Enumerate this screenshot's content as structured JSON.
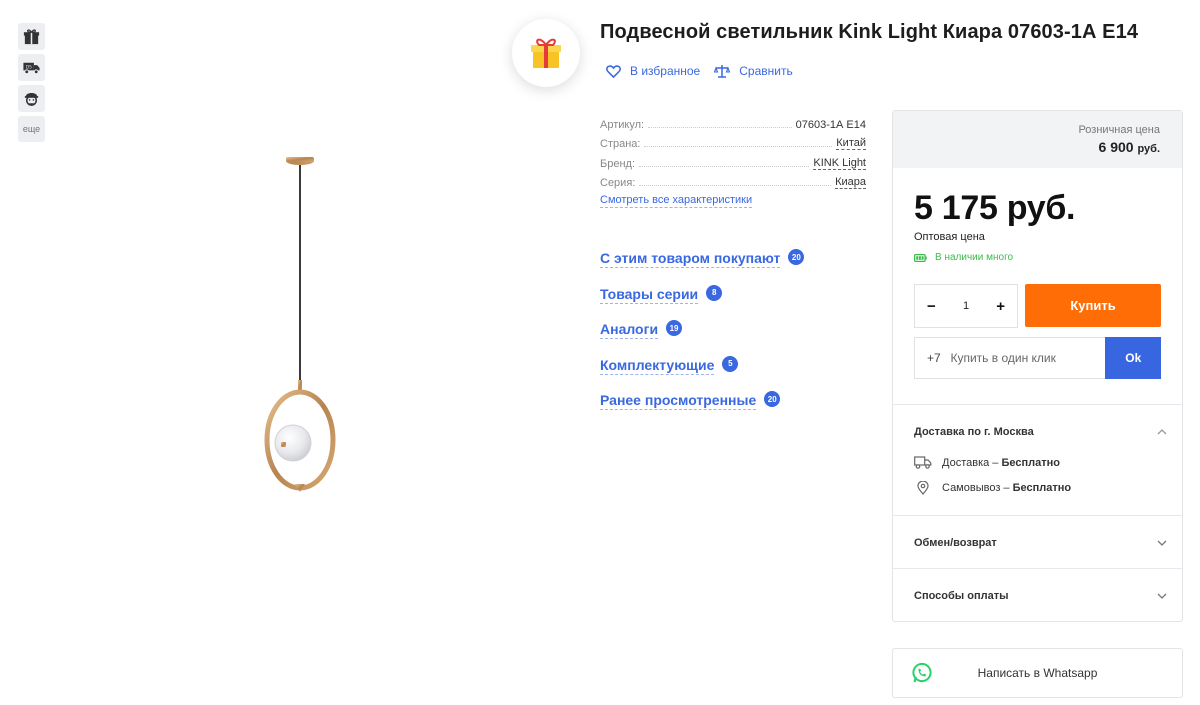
{
  "badges": {
    "gift_icon": "gift-icon",
    "delivery_icon": "delivery-truck-icon",
    "assembly_icon": "worker-icon",
    "more_label": "еще"
  },
  "product": {
    "title": "Подвесной светильник Kink Light Киара 07603-1А Е14",
    "favorite_label": "В избранное",
    "compare_label": "Сравнить"
  },
  "specs": [
    {
      "key": "Артикул:",
      "value": "07603-1А Е14"
    },
    {
      "key": "Страна:",
      "value": "Китай"
    },
    {
      "key": "Бренд:",
      "value": "KINK Light"
    },
    {
      "key": "Серия:",
      "value": "Киара"
    }
  ],
  "all_characteristics_label": "Смотреть все характеристики",
  "related": [
    {
      "label": "С этим товаром покупают",
      "count": "20"
    },
    {
      "label": "Товары серии",
      "count": "8"
    },
    {
      "label": "Аналоги",
      "count": "19"
    },
    {
      "label": "Комплектующие",
      "count": "5"
    },
    {
      "label": "Ранее просмотренные",
      "count": "20"
    }
  ],
  "price": {
    "retail_label": "Розничная цена",
    "retail_value": "6 900",
    "retail_currency": "руб.",
    "main_value": "5 175 руб.",
    "wholesale_label": "Оптовая цена",
    "stock_label": "В наличии много",
    "qty_minus": "−",
    "qty_value": "1",
    "qty_plus": "+",
    "buy_label": "Купить",
    "phone_prefix": "+7",
    "oneclick_placeholder": "Купить в один клик",
    "ok_label": "Ok"
  },
  "delivery": {
    "title": "Доставка по г. Москва",
    "rows": [
      {
        "label": "Доставка –",
        "value": "Бесплатно"
      },
      {
        "label": "Самовывоз –",
        "value": "Бесплатно"
      }
    ]
  },
  "accordions": {
    "exchange": "Обмен/возврат",
    "payment": "Способы оплаты"
  },
  "whatsapp_label": "Написать в Whatsapp",
  "colors": {
    "accent_blue": "#3968e0",
    "buy_orange": "#ff6d07",
    "stock_green": "#3dbb4b",
    "whatsapp_green": "#25d366"
  }
}
